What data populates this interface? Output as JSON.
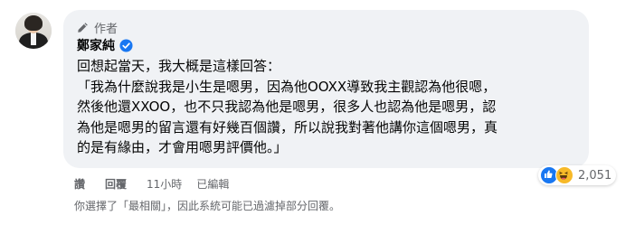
{
  "comment": {
    "author_tag": "作者",
    "author_name": "鄭家純",
    "text_lines": [
      "回想起當天，我大概是這樣回答：",
      "「我為什麼說我是小生是嗯男，因為他OOXX導致我主觀認為他很嗯，",
      "然後他還XXOO，也不只我認為他是嗯男，很多人也認為他是嗯男，認",
      "為他是嗯男的留言還有好幾百個讚，所以說我對著他講你這個嗯男，真",
      "的是有緣由，才會用嗯男評價他。」"
    ]
  },
  "reactions": {
    "icons": [
      "like-icon",
      "haha-icon"
    ],
    "count": "2,051"
  },
  "actions": {
    "like_label": "讚",
    "reply_label": "回覆",
    "time": "11小時",
    "edited_label": "已編輯"
  },
  "filter_note": "你選擇了「最相關」，因此系統可能已過濾掉部分回覆。",
  "colors": {
    "bubble": "#f0f2f5",
    "secondary_text": "#65676b",
    "verified": "#1877f2",
    "like": "#1877f2",
    "haha": "#f7b928"
  }
}
